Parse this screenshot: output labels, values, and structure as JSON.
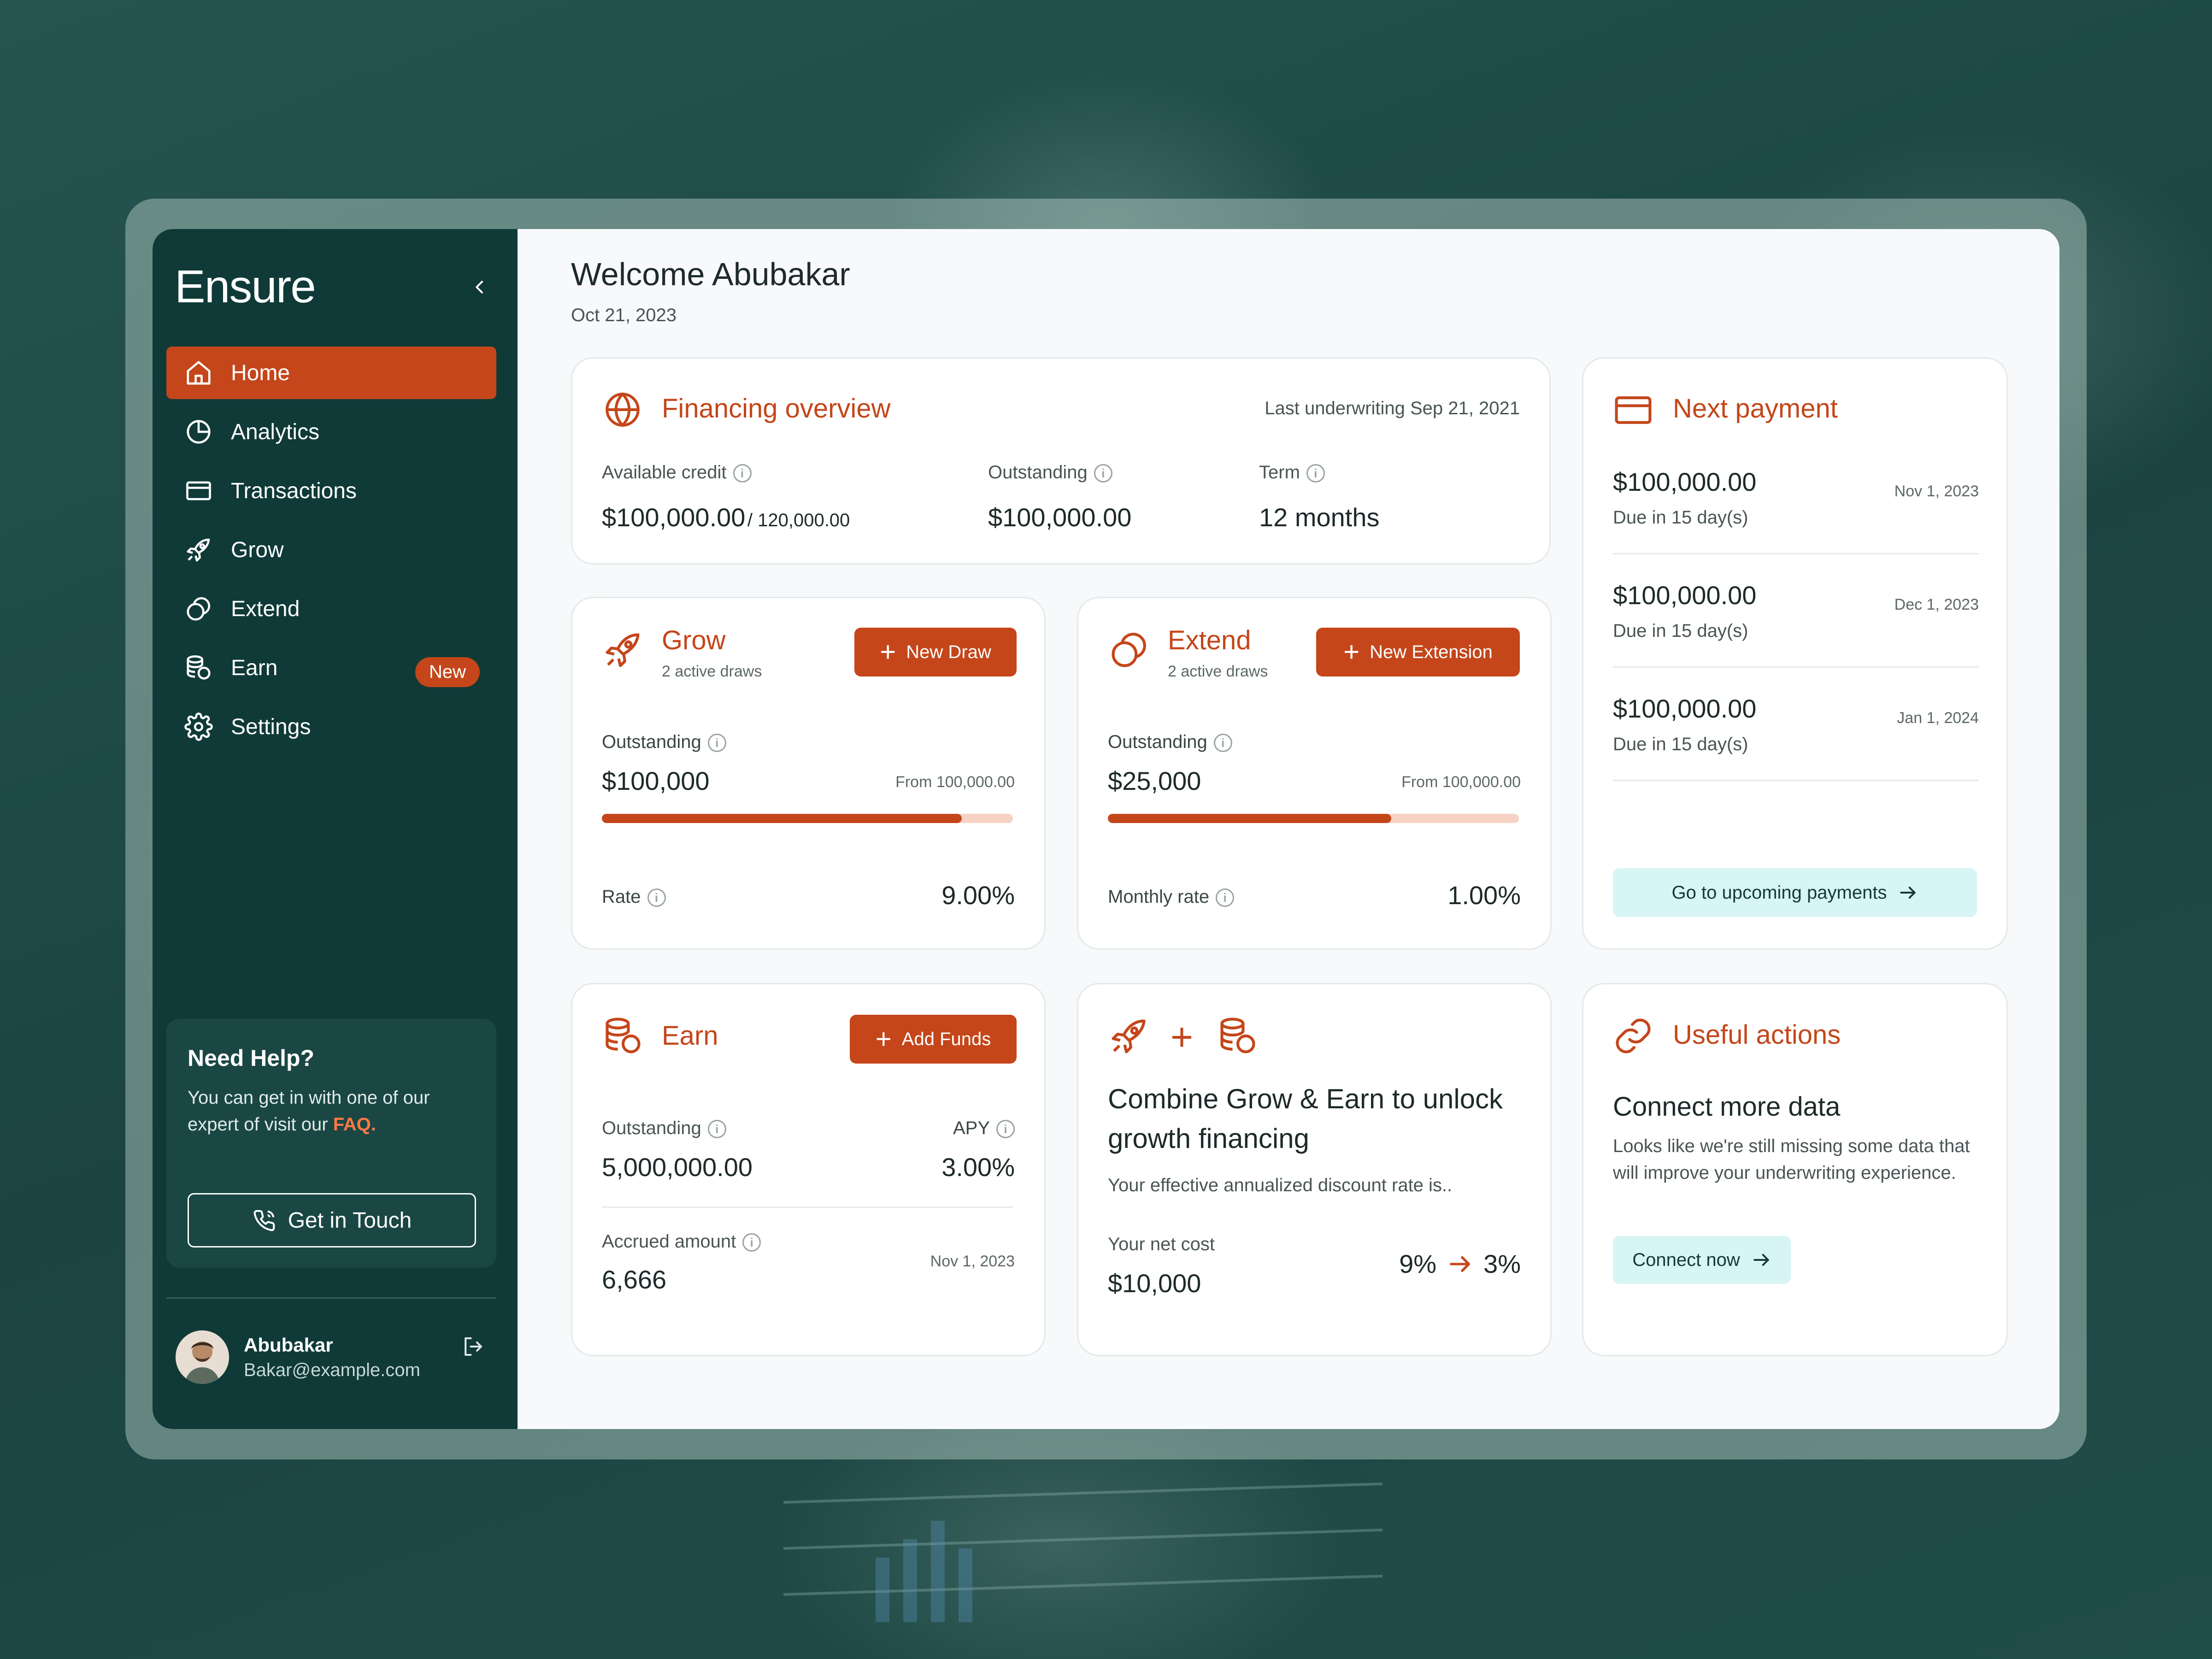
{
  "app": {
    "name": "Ensure"
  },
  "sidebar": {
    "items": [
      {
        "label": "Home",
        "icon": "home-icon",
        "active": true
      },
      {
        "label": "Analytics",
        "icon": "pie-chart-icon"
      },
      {
        "label": "Transactions",
        "icon": "card-icon"
      },
      {
        "label": "Grow",
        "icon": "rocket-icon"
      },
      {
        "label": "Extend",
        "icon": "extend-icon"
      },
      {
        "label": "Earn",
        "icon": "coins-icon",
        "badge": "New"
      },
      {
        "label": "Settings",
        "icon": "gear-icon"
      }
    ],
    "help": {
      "title": "Need Help?",
      "text": "You can get in with one of our expert of visit our ",
      "faq": "FAQ.",
      "button": "Get in Touch"
    },
    "user": {
      "name": "Abubakar",
      "email": "Bakar@example.com"
    }
  },
  "header": {
    "welcome": "Welcome Abubakar",
    "date": "Oct 21, 2023"
  },
  "financing": {
    "title": "Financing overview",
    "last_underwriting": "Last underwriting Sep 21, 2021",
    "available_label": "Available credit",
    "available_value": "$100,000.00",
    "available_total": "/ 120,000.00",
    "outstanding_label": "Outstanding",
    "outstanding_value": "$100,000.00",
    "term_label": "Term",
    "term_value": "12 months"
  },
  "grow": {
    "title": "Grow",
    "subtitle": "2 active draws",
    "button": "New Draw",
    "outstanding_label": "Outstanding",
    "outstanding_value": "$100,000",
    "from": "From 100,000.00",
    "progress": 0.875,
    "rate_label": "Rate",
    "rate_value": "9.00%"
  },
  "extend": {
    "title": "Extend",
    "subtitle": "2 active draws",
    "button": "New Extension",
    "outstanding_label": "Outstanding",
    "outstanding_value": "$25,000",
    "from": "From 100,000.00",
    "progress": 0.69,
    "rate_label": "Monthly rate",
    "rate_value": "1.00%"
  },
  "next_payment": {
    "title": "Next payment",
    "payments": [
      {
        "amount": "$100,000.00",
        "due": "Due in 15 day(s)",
        "date": "Nov 1, 2023"
      },
      {
        "amount": "$100,000.00",
        "due": "Due in 15 day(s)",
        "date": "Dec 1, 2023"
      },
      {
        "amount": "$100,000.00",
        "due": "Due in 15 day(s)",
        "date": "Jan 1, 2024"
      }
    ],
    "button": "Go to upcoming payments"
  },
  "earn": {
    "title": "Earn",
    "button": "Add Funds",
    "outstanding_label": "Outstanding",
    "outstanding_value": "5,000,000.00",
    "apy_label": "APY",
    "apy_value": "3.00%",
    "accrued_label": "Accrued amount",
    "accrued_value": "6,666",
    "accrued_date": "Nov 1, 2023"
  },
  "combine": {
    "plus": "+",
    "title": "Combine Grow & Earn to unlock growth financing",
    "text": "Your effective annualized discount rate is..",
    "net_cost_label": "Your net cost",
    "net_cost_value": "$10,000",
    "rate_from": "9%",
    "rate_to": "3%"
  },
  "useful": {
    "title": "Useful actions",
    "heading": "Connect more data",
    "text": "Looks like we're still missing some data that will improve your underwriting experience.",
    "button": "Connect now"
  },
  "colors": {
    "accent": "#c4461a",
    "sidebar": "#0f3a37",
    "teal_button": "#d7f5f4"
  }
}
